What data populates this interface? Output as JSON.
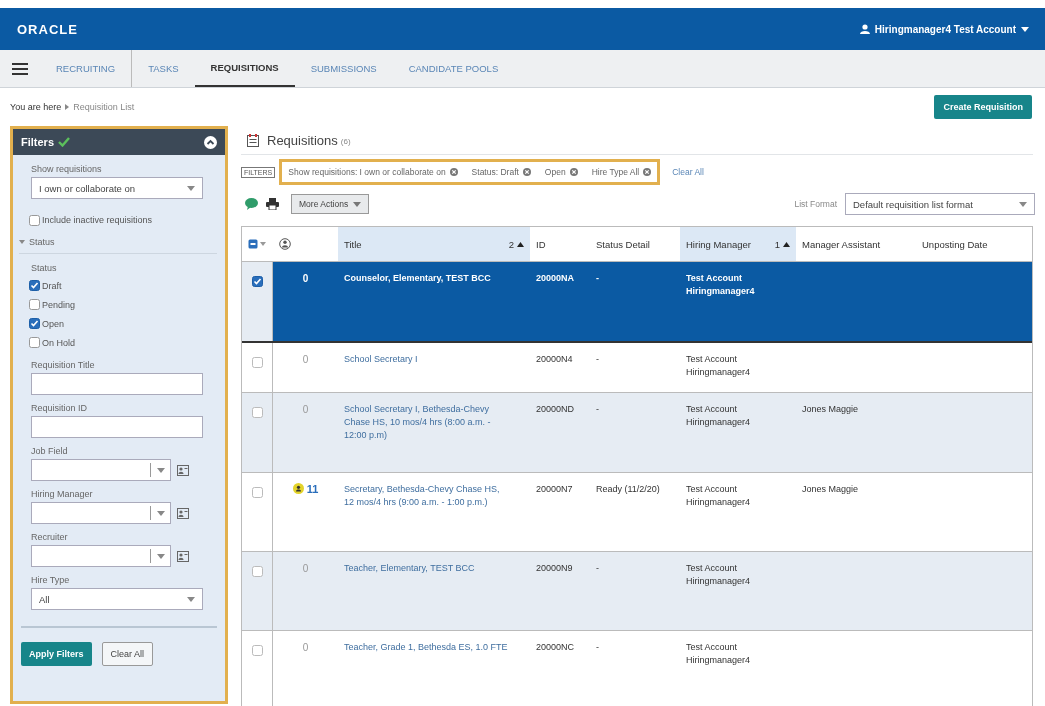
{
  "header": {
    "logo": "ORACLE",
    "account": "Hiringmanager4 Test Account"
  },
  "nav": [
    {
      "label": "RECRUITING",
      "selected": false
    },
    {
      "label": "TASKS",
      "selected": false
    },
    {
      "label": "REQUISITIONS",
      "selected": true
    },
    {
      "label": "SUBMISSIONS",
      "selected": false
    },
    {
      "label": "CANDIDATE POOLS",
      "selected": false
    }
  ],
  "breadcrumb": {
    "prefix": "You are here",
    "current": "Requisition List"
  },
  "create_button": "Create Requisition",
  "filters": {
    "title": "Filters",
    "applied": true,
    "show_label": "Show requisitions",
    "show_value": "I own or collaborate on",
    "include_inactive": {
      "label": "Include inactive requisitions",
      "checked": false
    },
    "section": {
      "label": "Status",
      "expanded": true
    },
    "status_label": "Status",
    "statuses": [
      {
        "label": "Draft",
        "checked": true
      },
      {
        "label": "Pending",
        "checked": false
      },
      {
        "label": "Open",
        "checked": true
      },
      {
        "label": "On Hold",
        "checked": false
      }
    ],
    "fields": [
      {
        "label": "Requisition Title",
        "kind": "text"
      },
      {
        "label": "Requisition ID",
        "kind": "text"
      },
      {
        "label": "Job Field",
        "kind": "picker"
      },
      {
        "label": "Hiring Manager",
        "kind": "picker"
      },
      {
        "label": "Recruiter",
        "kind": "picker"
      },
      {
        "label": "Hire Type",
        "kind": "select",
        "value": "All"
      }
    ],
    "apply": "Apply Filters",
    "clear": "Clear All"
  },
  "requisitions": {
    "title": "Requisitions",
    "count": "(6)",
    "filters_tag": "FILTERS",
    "chips": [
      "Show requisitions: I own or collaborate on",
      "Status: Draft",
      "Open",
      "Hire Type All"
    ],
    "clear_all": "Clear All",
    "more_actions": "More Actions",
    "list_format_label": "List Format",
    "list_format_value": "Default requisition list format",
    "columns": [
      {
        "label": "Title",
        "sort_order": "2"
      },
      {
        "label": "ID"
      },
      {
        "label": "Status Detail"
      },
      {
        "label": "Hiring Manager",
        "sort_order": "1"
      },
      {
        "label": "Manager Assistant"
      },
      {
        "label": "Unposting Date"
      }
    ],
    "rows": [
      {
        "selected": true,
        "checked": true,
        "alert": false,
        "count": "0",
        "title": "Counselor, Elementary, TEST BCC",
        "id": "20000NA",
        "status": "-",
        "manager": "Test Account Hiringmanager4"
      },
      {
        "selected": false,
        "checked": false,
        "alert": false,
        "count": "0",
        "title": "School Secretary I",
        "id": "20000N4",
        "status": "-",
        "manager": "Test Account Hiringmanager4"
      },
      {
        "selected": false,
        "checked": false,
        "alert": false,
        "count": "0",
        "title": "School Secretary I, Bethesda-Chevy Chase HS, 10 mos/4 hrs (8:00 a.m. - 12:00 p.m)",
        "id": "20000ND",
        "status": "-",
        "manager": "Test Account Hiringmanager4",
        "assistant": "Jones Maggie"
      },
      {
        "selected": false,
        "checked": false,
        "alert": true,
        "count": "11",
        "title": "Secretary, Bethesda-Chevy Chase HS, 12 mos/4 hrs (9:00 a.m. - 1:00 p.m.)",
        "id": "20000N7",
        "status": "Ready (11/2/20)",
        "manager": "Test Account Hiringmanager4",
        "assistant": "Jones Maggie"
      },
      {
        "selected": false,
        "checked": false,
        "alert": false,
        "count": "0",
        "title": "Teacher, Elementary, TEST BCC",
        "id": "20000N9",
        "status": "-",
        "manager": "Test Account Hiringmanager4"
      },
      {
        "selected": false,
        "checked": false,
        "alert": false,
        "count": "0",
        "title": "Teacher, Grade 1, Bethesda ES, 1.0 FTE",
        "id": "20000NC",
        "status": "-",
        "manager": "Test Account Hiringmanager4"
      }
    ]
  }
}
